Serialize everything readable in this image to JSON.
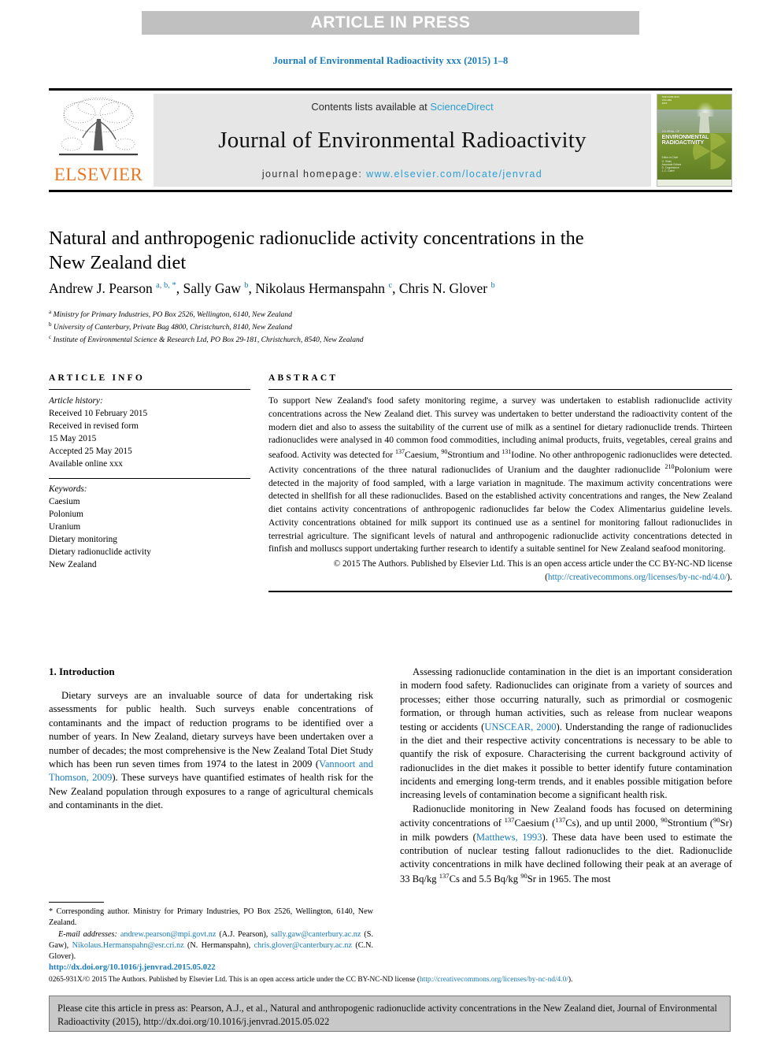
{
  "banner": {
    "text": "ARTICLE IN PRESS"
  },
  "running_head": {
    "text": "Journal of Environmental Radioactivity xxx (2015) 1–8"
  },
  "masthead": {
    "publisher_logo_label": "ELSEVIER",
    "contents_prefix": "Contents lists available at ",
    "contents_link": "ScienceDirect",
    "journal_title": "Journal of Environmental Radioactivity",
    "homepage_prefix": "journal homepage: ",
    "homepage_url": "www.elsevier.com/locate/jenvrad",
    "cover": {
      "line1": "JOURNAL OF",
      "line2": "ENVIRONMENTAL",
      "line3": "RADIOACTIVITY",
      "footer": "Editor-in-Chief\nG. Shaw\nAssociate Editors\nD. Copplestone\nJ.-C. Gariel"
    }
  },
  "article": {
    "title": "Natural and anthropogenic radionuclide activity concentrations in the New Zealand diet",
    "authors_html": "Andrew J. Pearson <sup>a, b, *</sup>, Sally Gaw <sup>b</sup>, Nikolaus Hermanspahn <sup>c</sup>, Chris N. Glover <sup>b</sup>",
    "affiliations": [
      {
        "marker": "a",
        "text": "Ministry for Primary Industries, PO Box 2526, Wellington, 6140, New Zealand"
      },
      {
        "marker": "b",
        "text": "University of Canterbury, Private Bag 4800, Christchurch, 8140, New Zealand"
      },
      {
        "marker": "c",
        "text": "Institute of Environmental Science & Research Ltd, PO Box 29-181, Christchurch, 8540, New Zealand"
      }
    ]
  },
  "article_info": {
    "heading": "ARTICLE INFO",
    "history_label": "Article history:",
    "history": [
      "Received 10 February 2015",
      "Received in revised form",
      "15 May 2015",
      "Accepted 25 May 2015",
      "Available online xxx"
    ],
    "keywords_label": "Keywords:",
    "keywords": [
      "Caesium",
      "Polonium",
      "Uranium",
      "Dietary monitoring",
      "Dietary radionuclide activity",
      "New Zealand"
    ]
  },
  "abstract": {
    "heading": "ABSTRACT",
    "body_html": "To support New Zealand's food safety monitoring regime, a survey was undertaken to establish radionuclide activity concentrations across the New Zealand diet. This survey was undertaken to better understand the radioactivity content of the modern diet and also to assess the suitability of the current use of milk as a sentinel for dietary radionuclide trends. Thirteen radionuclides were analysed in 40 common food commodities, including animal products, fruits, vegetables, cereal grains and seafood. Activity was detected for <sup>137</sup>Caesium, <sup>90</sup>Strontium and <sup>131</sup>Iodine. No other anthropogenic radionuclides were detected. Activity concentrations of the three natural radionuclides of Uranium and the daughter radionuclide <sup>210</sup>Polonium were detected in the majority of food sampled, with a large variation in magnitude. The maximum activity concentrations were detected in shellfish for all these radionuclides. Based on the established activity concentrations and ranges, the New Zealand diet contains activity concentrations of anthropogenic radionuclides far below the Codex Alimentarius guideline levels. Activity concentrations obtained for milk support its continued use as a sentinel for monitoring fallout radionuclides in terrestrial agriculture. The significant levels of natural and anthropogenic radionuclide activity concentrations detected in finfish and molluscs support undertaking further research to identify a suitable sentinel for New Zealand seafood monitoring.",
    "copyright_html": "© 2015 The Authors. Published by Elsevier Ltd. This is an open access article under the CC BY-NC-ND license (<span class=\"ref\">http://creativecommons.org/licenses/by-nc-nd/4.0/</span>)."
  },
  "body": {
    "section_heading": "1. Introduction",
    "left_paragraphs_html": [
      "Dietary surveys are an invaluable source of data for undertaking risk assessments for public health. Such surveys enable concentrations of contaminants and the impact of reduction programs to be identified over a number of years. In New Zealand, dietary surveys have been undertaken over a number of decades; the most comprehensive is the New Zealand Total Diet Study which has been run seven times from 1974 to the latest in 2009 (<span class=\"ref\">Vannoort and Thomson, 2009</span>). These surveys have quantified estimates of health risk for the New Zealand population through exposures to a range of agricultural chemicals and contaminants in the diet."
    ],
    "right_paragraphs_html": [
      "Assessing radionuclide contamination in the diet is an important consideration in modern food safety. Radionuclides can originate from a variety of sources and processes; either those occurring naturally, such as primordial or cosmogenic formation, or through human activities, such as release from nuclear weapons testing or accidents (<span class=\"ref\">UNSCEAR, 2000</span>). Understanding the range of radionuclides in the diet and their respective activity concentrations is necessary to be able to quantify the risk of exposure. Characterising the current background activity of radionuclides in the diet makes it possible to better identify future contamination incidents and emerging long-term trends, and it enables possible mitigation before increasing levels of contamination become a significant health risk.",
      "Radionuclide monitoring in New Zealand foods has focused on determining activity concentrations of <sup>137</sup>Caesium (<sup>137</sup>Cs), and up until 2000, <sup>90</sup>Strontium (<sup>90</sup>Sr) in milk powders (<span class=\"ref\">Matthews, 1993</span>). These data have been used to estimate the contribution of nuclear testing fallout radionuclides to the diet. Radionuclide activity concentrations in milk have declined following their peak at an average of 33 Bq/kg <sup>137</sup>Cs and 5.5 Bq/kg <sup>90</sup>Sr in 1965. The most"
    ]
  },
  "footnote": {
    "corresponding_html": "* Corresponding author. Ministry for Primary Industries, PO Box 2526, Wellington, 6140, New Zealand.",
    "emails_html": "<span class=\"ital\">E-mail addresses:</span> <span class=\"lnk\">andrew.pearson@mpi.govt.nz</span> (A.J. Pearson), <span class=\"lnk\">sally.gaw@canterbury.ac.nz</span> (S. Gaw), <span class=\"lnk\">Nikolaus.Hermanspahn@esr.cri.nz</span> (N. Hermanspahn), <span class=\"lnk\">chris.glover@canterbury.ac.nz</span> (C.N. Glover)."
  },
  "footer": {
    "doi": "http://dx.doi.org/10.1016/j.jenvrad.2015.05.022",
    "issn_html": "0265-931X/© 2015 The Authors. Published by Elsevier Ltd. This is an open access article under the CC BY-NC-ND license (<span class=\"lnk\">http://creativecommons.org/licenses/by-nc-nd/4.0/</span>).",
    "cite_text": "Please cite this article in press as: Pearson, A.J., et al., Natural and anthropogenic radionuclide activity concentrations in the New Zealand diet, Journal of Environmental Radioactivity (2015), http://dx.doi.org/10.1016/j.jenvrad.2015.05.022"
  },
  "colors": {
    "link_blue": "#1a7bb9",
    "light_blue": "#2a9fd6",
    "elsevier_orange": "#e87722",
    "band_gray": "#c0c0c0",
    "masthead_gray": "#e6e6e6",
    "cite_box_gray": "#c8c8c8"
  }
}
